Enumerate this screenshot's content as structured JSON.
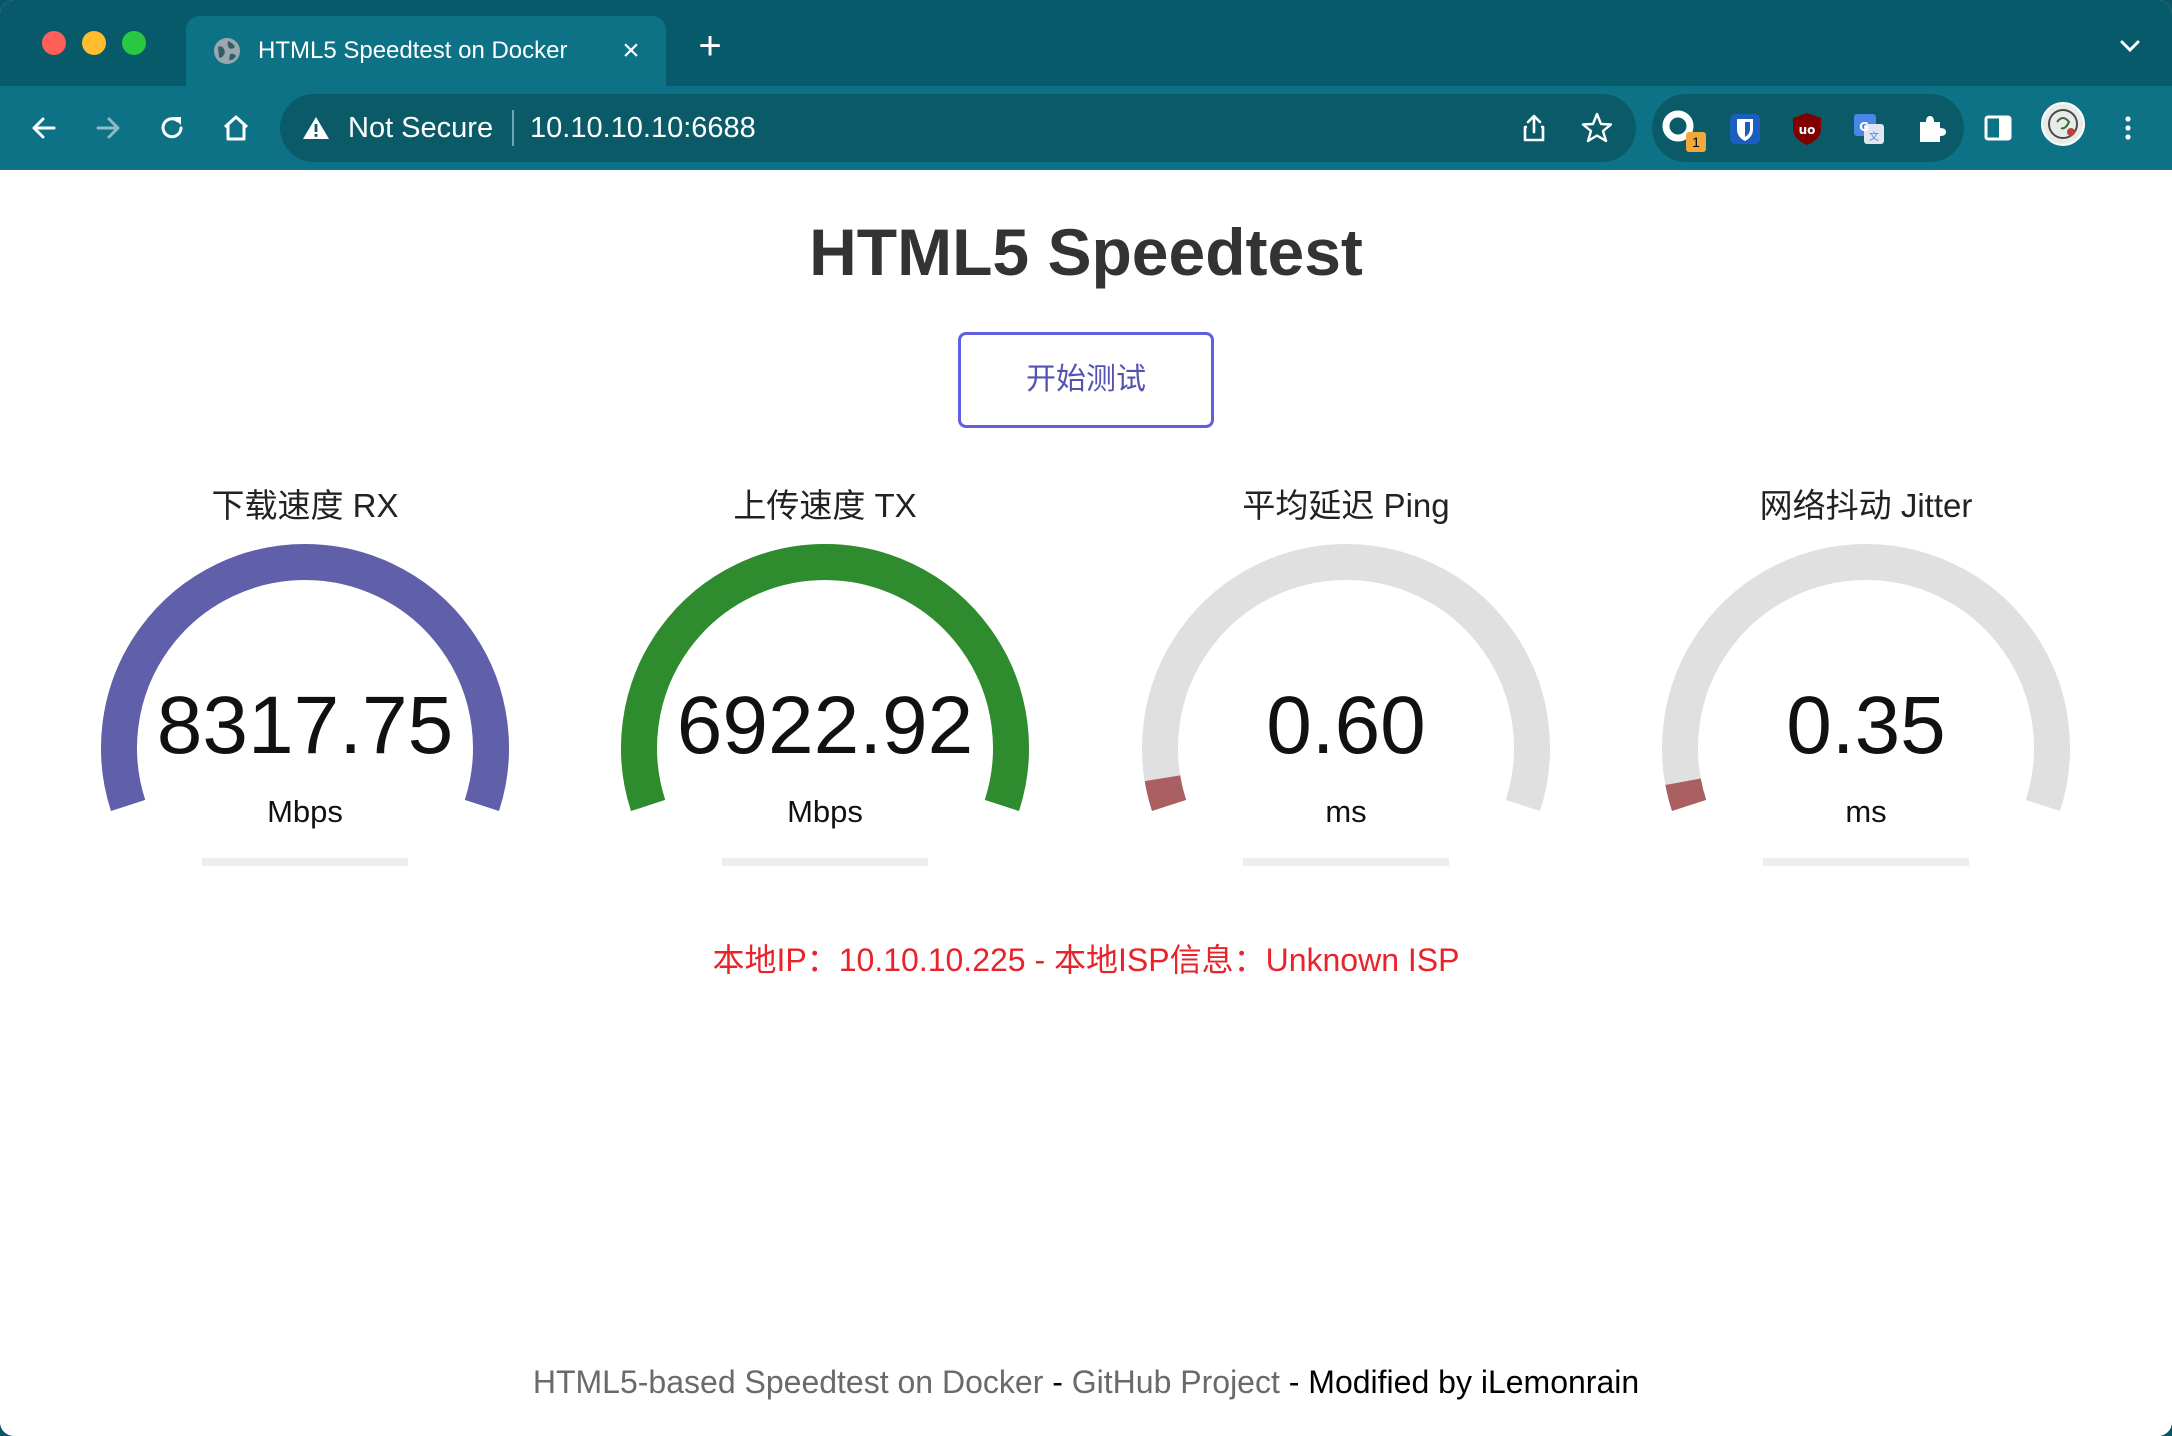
{
  "browser": {
    "tab": {
      "title": "HTML5 Speedtest on Docker"
    },
    "address": {
      "security_label": "Not Secure",
      "url": "10.10.10.10:6688"
    },
    "extensions": {
      "badge_count": "1"
    }
  },
  "page": {
    "title": "HTML5 Speedtest",
    "start_button": "开始测试",
    "gauges": [
      {
        "label": "下载速度 RX",
        "value": "8317.75",
        "unit": "Mbps",
        "fill": 1.0,
        "color": "#6060aa"
      },
      {
        "label": "上传速度 TX",
        "value": "6922.92",
        "unit": "Mbps",
        "fill": 1.0,
        "color": "#2e8b2e"
      },
      {
        "label": "平均延迟 Ping",
        "value": "0.60",
        "unit": "ms",
        "fill": 0.04,
        "color": "#aa6060"
      },
      {
        "label": "网络抖动 Jitter",
        "value": "0.35",
        "unit": "ms",
        "fill": 0.035,
        "color": "#aa6060"
      }
    ],
    "ip_info": "本地IP：10.10.10.225 - 本地ISP信息：Unknown ISP",
    "footer": {
      "project_link": "HTML5-based Speedtest on Docker",
      "sep1": " - ",
      "github_link": "GitHub Project",
      "sep2": " - ",
      "modified": "Modified by iLemonrain"
    }
  },
  "colors": {
    "chrome_dark": "#075a6a",
    "chrome_toolbar": "#0d7285",
    "gauge_track": "#e0e0e0",
    "ip_text": "#e8232a",
    "button_border": "#5f5fe0"
  }
}
